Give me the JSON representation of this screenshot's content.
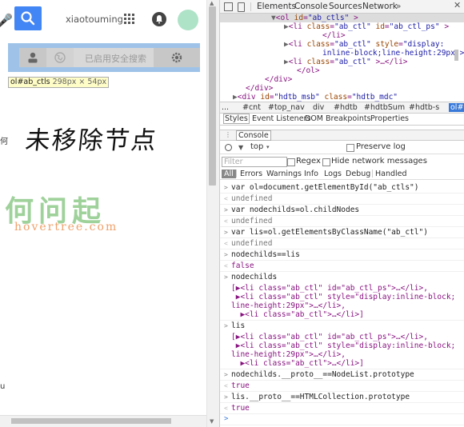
{
  "page": {
    "username": "xiaotouming",
    "safe_search_label": "已启用安全搜索",
    "tooltip_selector": "ol#ab_ctls",
    "tooltip_size": "298px × 54px",
    "handwritten_note": "未移除节点",
    "edge_text_1": "何",
    "edge_text_2": "u",
    "logo_cn": "何问起",
    "logo_en": "hovertree.com"
  },
  "devtools": {
    "tabs": [
      "Elements",
      "Console",
      "Sources",
      "Network",
      "»"
    ],
    "active_tab": "Elements",
    "elements_lines": [
      {
        "indent": 16,
        "prefix": "▼",
        "tag_open": "<ol ",
        "attrs": [
          [
            "id",
            "\"ab_ctls\""
          ]
        ],
        "tail": ">"
      },
      {
        "indent": 20,
        "prefix": "▶",
        "tag_open": "<li ",
        "attrs": [
          [
            "class",
            "\"ab_ctl\""
          ],
          [
            "id",
            "\"ab_ctl_ps\""
          ]
        ],
        "tail": ">"
      },
      {
        "indent": 32,
        "prefix": "",
        "tag_open": "</li>",
        "attrs": [],
        "tail": ""
      },
      {
        "indent": 20,
        "prefix": "▶",
        "tag_open": "<li ",
        "attrs": [
          [
            "class",
            "\"ab_ctl\""
          ],
          [
            "style",
            "\"display:"
          ]
        ],
        "tail": ""
      },
      {
        "indent": 32,
        "prefix": "",
        "tag_open": "",
        "attrs": [],
        "tail": "inline-block;line-height:29px\">…</li>"
      },
      {
        "indent": 20,
        "prefix": "▶",
        "tag_open": "<li ",
        "attrs": [
          [
            "class",
            "\"ab_ctl\""
          ]
        ],
        "tail": ">…</li>"
      },
      {
        "indent": 24,
        "prefix": "",
        "tag_open": "</ol>",
        "attrs": [],
        "tail": ""
      },
      {
        "indent": 14,
        "prefix": "",
        "tag_open": "</div>",
        "attrs": [],
        "tail": ""
      },
      {
        "indent": 8,
        "prefix": "",
        "tag_open": "</div>",
        "attrs": [],
        "tail": ""
      },
      {
        "indent": 4,
        "prefix": "▶",
        "tag_open": "<div ",
        "attrs": [
          [
            "id",
            "\"hdtb_msb\""
          ],
          [
            "class",
            "\"hdtb_mdc\""
          ]
        ],
        "tail": ""
      }
    ],
    "breadcrumbs": [
      "...",
      "#cnt",
      "#top_nav",
      "div",
      "#hdtb",
      "#hdtbSum",
      "#hdtb-s",
      "ol#ab_ctls"
    ],
    "subtabs": [
      "Styles",
      "Event Listeners",
      "DOM Breakpoints",
      "Properties"
    ],
    "drawer_tab": "Console",
    "context": "top",
    "preserve_log_label": "Preserve log",
    "filter_placeholder": "Filter",
    "regex_label": "Regex",
    "hide_network_label": "Hide network messages",
    "levels": [
      "All",
      "Errors",
      "Warnings",
      "Info",
      "Logs",
      "Debug",
      "Handled"
    ],
    "console": [
      {
        "type": "in",
        "text": "var ol=document.getElementById(\"ab_ctls\")"
      },
      {
        "type": "out",
        "text": "undefined"
      },
      {
        "type": "in",
        "text": "var nodechilds=ol.childNodes"
      },
      {
        "type": "out",
        "text": "undefined"
      },
      {
        "type": "in",
        "text": "var lis=ol.getElementsByClassName(\"ab_ctl\")"
      },
      {
        "type": "out",
        "text": "undefined"
      },
      {
        "type": "in",
        "text": "nodechilds==lis"
      },
      {
        "type": "bool",
        "text": "false"
      },
      {
        "type": "in",
        "text": "nodechilds"
      },
      {
        "type": "res",
        "text": "[▶<li class=\"ab_ctl\" id=\"ab_ctl_ps\">…</li>,"
      },
      {
        "type": "res",
        "text": " ▶<li class=\"ab_ctl\" style=\"display:inline-block;"
      },
      {
        "type": "res",
        "text": "line-height:29px\">…</li>,"
      },
      {
        "type": "res",
        "text": "  ▶<li class=\"ab_ctl\">…</li>]"
      },
      {
        "type": "in",
        "text": "lis"
      },
      {
        "type": "res",
        "text": "[▶<li class=\"ab_ctl\" id=\"ab_ctl_ps\">…</li>,"
      },
      {
        "type": "res",
        "text": " ▶<li class=\"ab_ctl\" style=\"display:inline-block;"
      },
      {
        "type": "res",
        "text": "line-height:29px\">…</li>,"
      },
      {
        "type": "res",
        "text": "  ▶<li class=\"ab_ctl\">…</li>]"
      },
      {
        "type": "in",
        "text": "nodechilds.__proto__==NodeList.prototype"
      },
      {
        "type": "bool",
        "text": "true"
      },
      {
        "type": "in",
        "text": "lis.__proto__==HTMLCollection.prototype"
      },
      {
        "type": "bool",
        "text": "true"
      },
      {
        "type": "prompt",
        "text": ""
      }
    ]
  },
  "colors": {
    "accent": "#4285f4",
    "highlight": "#9fc3e8",
    "tooltip_bg": "#fffdc7",
    "selected_crumb": "#3879d9",
    "logo_green": "#9fd19b",
    "logo_orange": "#f0a16a"
  }
}
